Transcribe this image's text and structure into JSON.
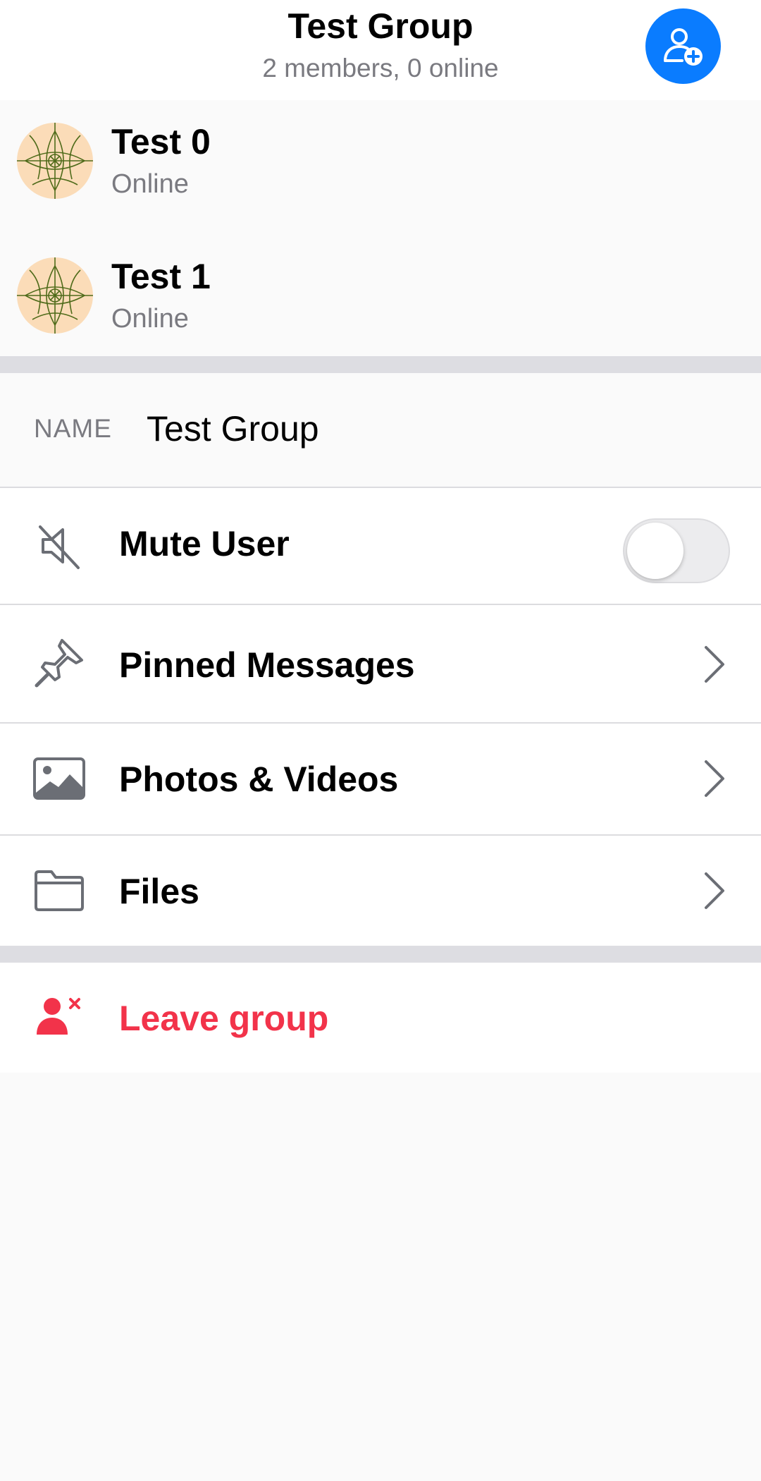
{
  "header": {
    "title": "Test Group",
    "subtitle": "2 members, 0 online",
    "add_member_icon": "add-user-icon",
    "accent_color": "#0a7cff"
  },
  "members": [
    {
      "name": "Test 0",
      "status": "Online",
      "avatar_icon": "geometric-pattern-avatar"
    },
    {
      "name": "Test 1",
      "status": "Online",
      "avatar_icon": "geometric-pattern-avatar"
    }
  ],
  "group_name": {
    "label": "NAME",
    "value": "Test Group"
  },
  "settings": {
    "mute": {
      "label": "Mute User",
      "icon": "speaker-muted-icon",
      "enabled": false
    },
    "pinned": {
      "label": "Pinned Messages",
      "icon": "pin-icon"
    },
    "photos": {
      "label": "Photos & Videos",
      "icon": "image-icon"
    },
    "files": {
      "label": "Files",
      "icon": "folder-icon"
    }
  },
  "leave": {
    "label": "Leave group",
    "icon": "remove-user-icon",
    "color": "#f2334a"
  }
}
